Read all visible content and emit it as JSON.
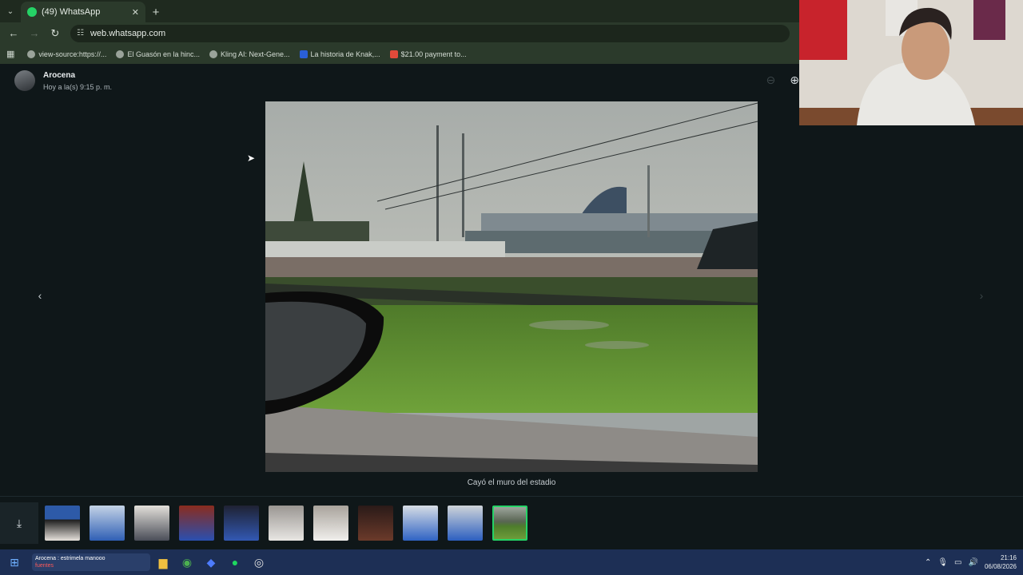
{
  "browser": {
    "tab_title": "(49) WhatsApp",
    "new_tab_symbol": "+",
    "close_symbol": "✕",
    "url": "web.whatsapp.com",
    "bookmarks": [
      {
        "label": "view-source:https://..."
      },
      {
        "label": "El Guasón en la hinc..."
      },
      {
        "label": "Kling AI: Next-Gene..."
      },
      {
        "label": "La historia de Knak,..."
      },
      {
        "label": "$21.00 payment to..."
      }
    ]
  },
  "viewer": {
    "contact_name": "Arocena",
    "timestamp": "Hoy a la(s) 9:15 p. m.",
    "caption": "Cayó el muro del estadio",
    "thumbnails_count": 11,
    "active_thumbnail_index": 10
  },
  "taskbar": {
    "ticker_line1": "Arocena : estrimela manooo",
    "ticker_line2": "fuentes",
    "time": "21:16",
    "date": "06/08/2026"
  },
  "icons": {
    "back": "back-arrow-icon",
    "forward": "forward-arrow-icon",
    "reload": "reload-icon",
    "zoom": "zoom-in-icon",
    "download": "download-icon"
  },
  "colors": {
    "whatsapp_green": "#25d366",
    "viewer_bg": "#0f1719"
  }
}
